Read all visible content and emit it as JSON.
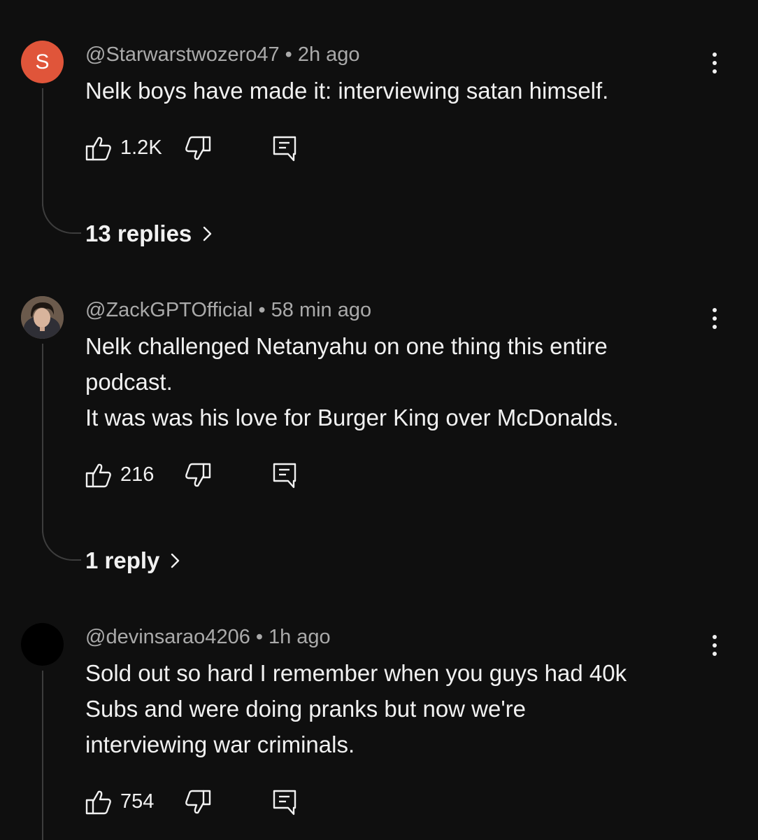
{
  "comments": [
    {
      "avatar": {
        "type": "letter",
        "letter": "S",
        "color": "#e0553a"
      },
      "handle": "@Starwarstwozero47",
      "separator": "•",
      "time": "2h ago",
      "lines": [
        "Nelk boys have made it: interviewing satan himself."
      ],
      "likes": "1.2K",
      "replies_label": "13 replies"
    },
    {
      "avatar": {
        "type": "photo",
        "description_icon": "user-photo-avatar"
      },
      "handle": "@ZackGPTOfficial",
      "separator": "•",
      "time": "58 min ago",
      "lines": [
        "Nelk challenged Netanyahu on one thing this entire",
        "podcast.",
        "It was was his love for Burger King over McDonalds."
      ],
      "likes": "216",
      "replies_label": "1 reply"
    },
    {
      "avatar": {
        "type": "solid",
        "color": "#000000"
      },
      "handle": "@devinsarao4206",
      "separator": "•",
      "time": "1h ago",
      "lines": [
        "Sold out so hard I remember when you guys had 40k",
        "Subs and were doing pranks but now we're",
        "interviewing war criminals."
      ],
      "likes": "754"
    }
  ],
  "icons": {
    "like": "thumb-up-icon",
    "dislike": "thumb-down-icon",
    "reply": "comment-reply-icon",
    "more": "more-vertical-icon",
    "chevron": "chevron-right-icon"
  },
  "colors": {
    "background": "#0f0f0f",
    "text_primary": "#f1f1f1",
    "text_secondary": "#aaaaaa",
    "thread_line": "#3d3d3d"
  }
}
